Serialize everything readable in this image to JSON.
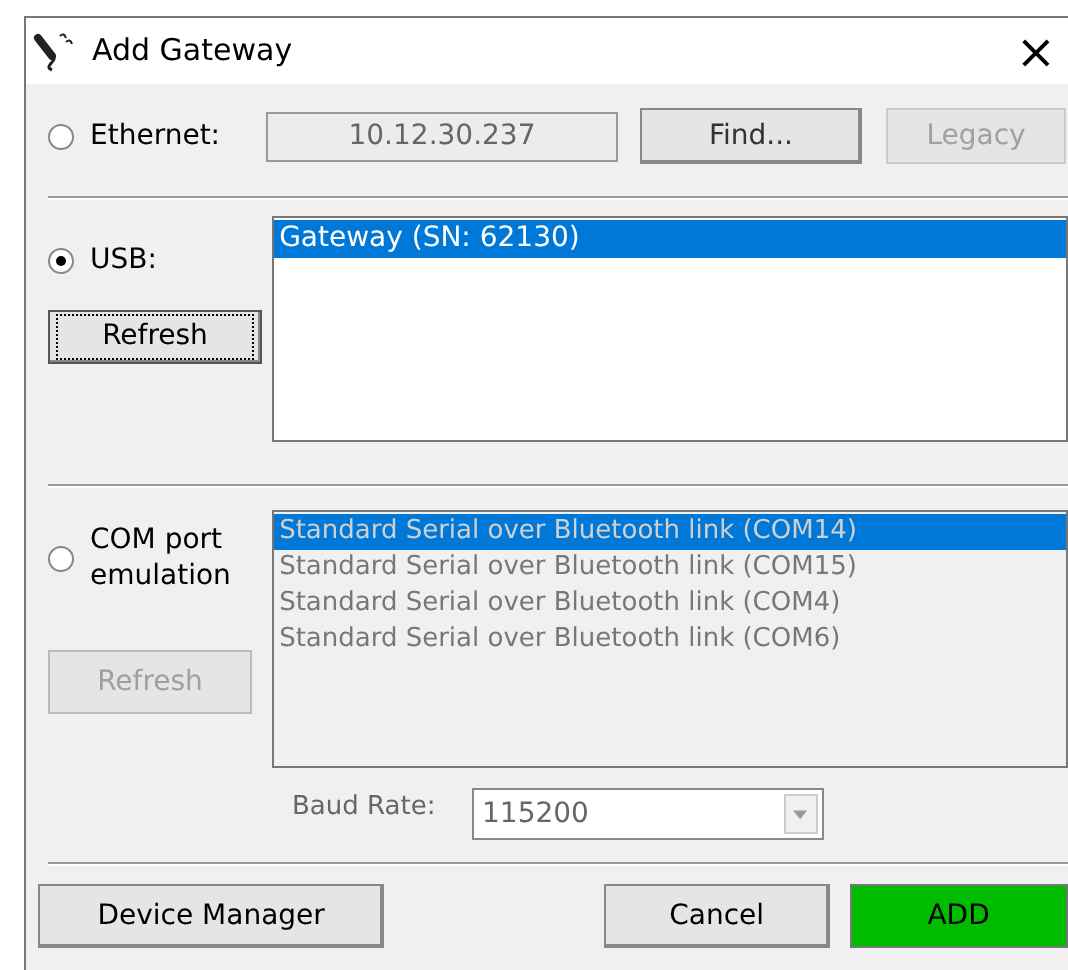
{
  "window": {
    "title": "Add Gateway",
    "close": "×"
  },
  "ethernet": {
    "label": "Ethernet:",
    "selected": false,
    "address": "10.12.30.237",
    "find": "Find...",
    "legacy": {
      "label": "Legacy",
      "disabled": true
    }
  },
  "usb": {
    "label": "USB:",
    "selected": true,
    "refresh": {
      "label": "Refresh",
      "disabled": false
    },
    "items": [
      {
        "label": "Gateway (SN: 62130)",
        "selected": true
      }
    ]
  },
  "com": {
    "label": "COM port emulation",
    "selected": false,
    "disabled": true,
    "refresh": {
      "label": "Refresh",
      "disabled": true
    },
    "items": [
      {
        "label": "Standard Serial over Bluetooth link (COM14)",
        "selected": true
      },
      {
        "label": "Standard Serial over Bluetooth link (COM15)",
        "selected": false
      },
      {
        "label": "Standard Serial over Bluetooth link (COM4)",
        "selected": false
      },
      {
        "label": "Standard Serial over Bluetooth link (COM6)",
        "selected": false
      }
    ],
    "baud_label": "Baud Rate:",
    "baud_value": "115200"
  },
  "buttons": [
    {
      "label": "Device Manager",
      "kind": "normal"
    },
    {
      "label": "Cancel",
      "kind": "normal"
    },
    {
      "label": "ADD",
      "kind": "primary"
    }
  ]
}
